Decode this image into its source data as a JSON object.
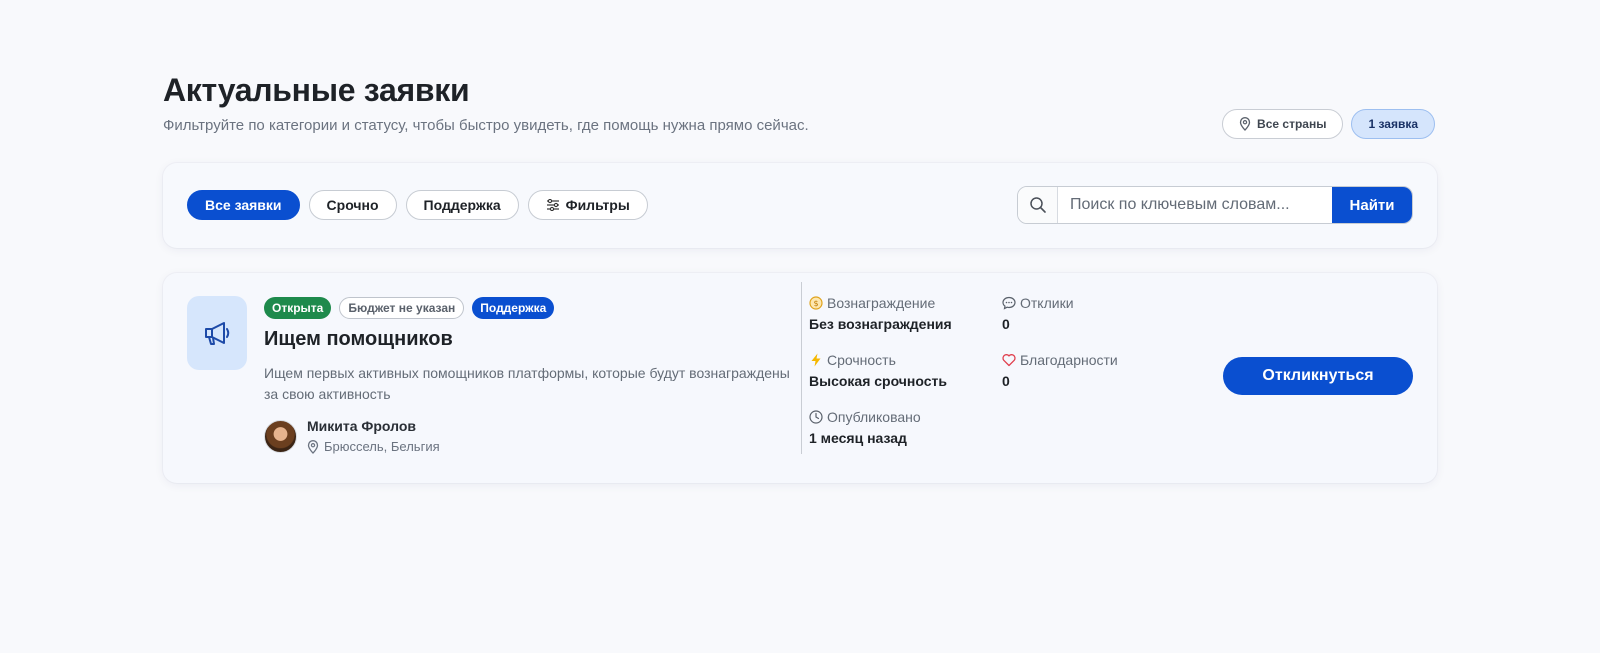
{
  "header": {
    "title": "Актуальные заявки",
    "subtitle": "Фильтруйте по категории и статусу, чтобы быстро увидеть, где помощь нужна прямо сейчас.",
    "country_label": "Все страны",
    "count_label": "1 заявка"
  },
  "filters": {
    "chips": [
      {
        "label": "Все заявки",
        "active": true
      },
      {
        "label": "Срочно",
        "active": false
      },
      {
        "label": "Поддержка",
        "active": false
      },
      {
        "label": "Фильтры",
        "active": false
      }
    ],
    "search": {
      "placeholder": "Поиск по ключевым словам...",
      "value": "",
      "button_label": "Найти"
    }
  },
  "request": {
    "badges": {
      "status": "Открыта",
      "budget": "Бюджет не указан",
      "category": "Поддержка"
    },
    "title": "Ищем помощников",
    "description": "Ищем первых активных помощников платформы, которые будут вознаграждены за свою активность",
    "author": {
      "name": "Микита Фролов",
      "location": "Брюссель, Бельгия"
    },
    "stats": {
      "reward": {
        "label": "Вознаграждение",
        "value": "Без вознаграждения"
      },
      "responses": {
        "label": "Отклики",
        "value": "0"
      },
      "urgency": {
        "label": "Срочность",
        "value": "Высокая срочность"
      },
      "thanks": {
        "label": "Благодарности",
        "value": "0"
      },
      "published": {
        "label": "Опубликовано",
        "value": "1 месяц назад"
      }
    },
    "respond_label": "Откликнуться"
  },
  "colors": {
    "accent": "#0a4fd0",
    "status_open": "#1e8a4c",
    "background": "#f8f9fc"
  }
}
